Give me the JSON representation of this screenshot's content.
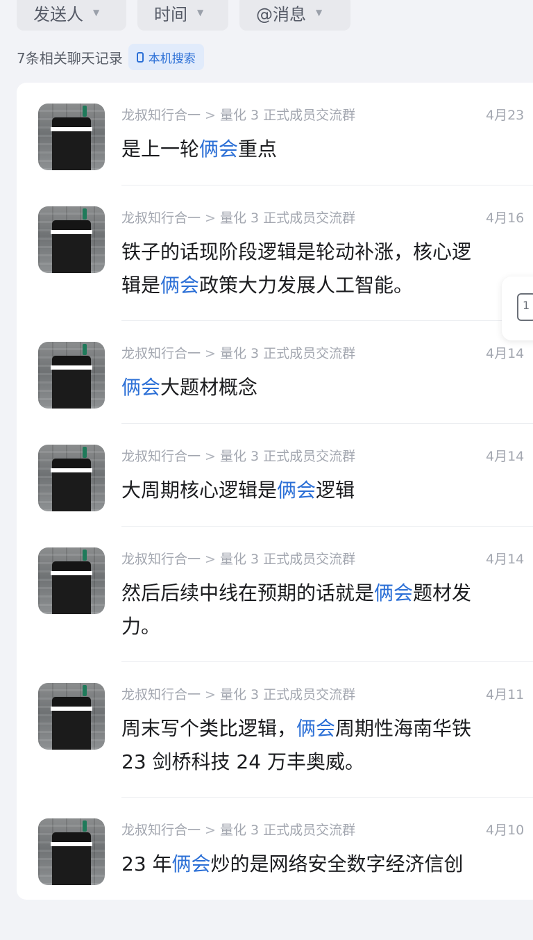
{
  "filters": [
    {
      "label": "发送人"
    },
    {
      "label": "时间"
    },
    {
      "label": "@消息"
    }
  ],
  "summary": {
    "count_text": "7条相关聊天记录",
    "local_search_label": "本机搜索"
  },
  "results": [
    {
      "sender": "龙叔知行合一",
      "group": "量化 3 正式成员交流群",
      "date": "4月23",
      "lines": [
        [
          "是上一轮",
          ""
        ],
        [
          "俩会",
          "hl"
        ],
        [
          "重点",
          ""
        ]
      ]
    },
    {
      "sender": "龙叔知行合一",
      "group": "量化 3 正式成员交流群",
      "date": "4月16",
      "line1": "铁子的话现阶段逻辑是轮动补涨，核心逻",
      "line2_pre": "辑是",
      "line2_hl": "俩会",
      "line2_post": "政策大力发展人工智能。"
    },
    {
      "sender": "龙叔知行合一",
      "group": "量化 3 正式成员交流群",
      "date": "4月14",
      "pre": "",
      "hl": "俩会",
      "post": "大题材概念"
    },
    {
      "sender": "龙叔知行合一",
      "group": "量化 3 正式成员交流群",
      "date": "4月14",
      "pre": "大周期核心逻辑是",
      "hl": "俩会",
      "post": "逻辑"
    },
    {
      "sender": "龙叔知行合一",
      "group": "量化 3 正式成员交流群",
      "date": "4月14",
      "pre": "然后后续中线在预期的话就是",
      "hl": "俩会",
      "post": "题材发",
      "line2": "力。"
    },
    {
      "sender": "龙叔知行合一",
      "group": "量化 3 正式成员交流群",
      "date": "4月11",
      "pre": "周末写个类比逻辑，",
      "hl": "俩会",
      "post": "周期性海南华铁",
      "line2": " 23 剑桥科技 24 万丰奥威。"
    },
    {
      "sender": "龙叔知行合一",
      "group": "量化 3 正式成员交流群",
      "date": "4月10",
      "pre": "23 年",
      "hl": "俩会",
      "post": "炒的是网络安全数字经济信创"
    }
  ],
  "floating": {
    "icon_text": "1"
  },
  "icons": {
    "filter_caret": "caret-down-icon",
    "local_search": "phone-icon",
    "breadcrumb": "chevron-right-icon",
    "floating": "page-icon"
  },
  "colors": {
    "highlight": "#2b6fd6",
    "background": "#f2f3f7"
  }
}
